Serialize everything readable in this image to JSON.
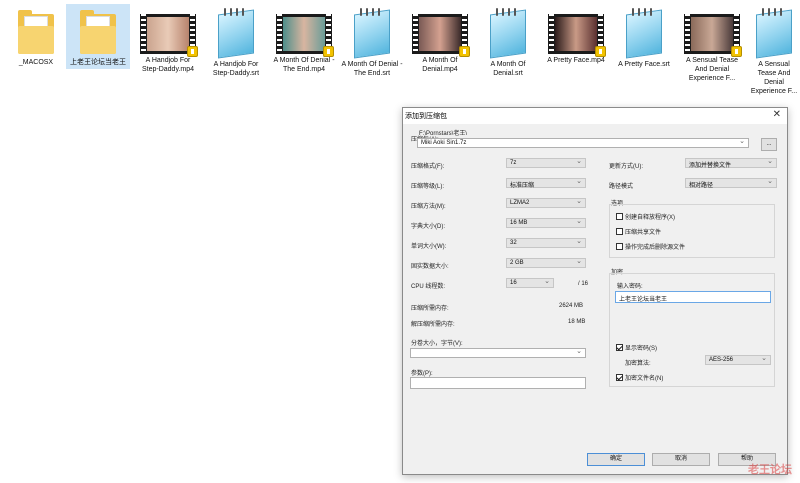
{
  "files": [
    {
      "name": "_MACOSX",
      "kind": "folder"
    },
    {
      "name": "上老王论坛当老王",
      "kind": "folder"
    },
    {
      "name": "A Handjob For Step-Daddy.mp4",
      "kind": "video"
    },
    {
      "name": "A Handjob For Step-Daddy.srt",
      "kind": "notepad"
    },
    {
      "name": "A Month Of Denial - The End.mp4",
      "kind": "video"
    },
    {
      "name": "A Month Of Denial - The End.srt",
      "kind": "notepad"
    },
    {
      "name": "A Month Of Denial.mp4",
      "kind": "video"
    },
    {
      "name": "A Month Of Denial.srt",
      "kind": "notepad"
    },
    {
      "name": "A Pretty Face.mp4",
      "kind": "video"
    },
    {
      "name": "A Pretty Face.srt",
      "kind": "notepad"
    },
    {
      "name": "A Sensual Tease And Denial Experience F...",
      "kind": "video"
    },
    {
      "name": "A Sensual Tease And Denial Experience F...",
      "kind": "notepad"
    }
  ],
  "dialog": {
    "title": "添加到压缩包",
    "close": "✕",
    "archive_label": "压缩包(A):",
    "archive_path": "F:\\Pornstars\\老王\\",
    "archive_name": "Miki Aoki Sin1.7z",
    "browse": "...",
    "format_label": "压缩格式(F):",
    "format_value": "7z",
    "level_label": "压缩等级(L):",
    "level_value": "标准压缩",
    "method_label": "压缩方法(M):",
    "method_value": "LZMA2",
    "dict_label": "字典大小(D):",
    "dict_value": "16 MB",
    "word_label": "单词大小(W):",
    "word_value": "32",
    "solid_label": "固实数据大小:",
    "solid_value": "2 GB",
    "threads_label": "CPU 线程数:",
    "threads_value": "16",
    "threads_max": "/ 16",
    "mem_comp_label": "压缩所需内存:",
    "mem_comp_value": "2624 MB",
    "mem_decomp_label": "解压缩所需内存:",
    "mem_decomp_value": "18 MB",
    "split_label": "分卷大小，字节(V):",
    "split_value": "",
    "params_label": "参数(P):",
    "params_value": "",
    "update_label": "更新方式(U):",
    "update_value": "添加并替换文件",
    "path_label": "路径模式",
    "path_value": "相对路径",
    "options_title": "选项",
    "opt_sfx": "创建自释放程序(X)",
    "opt_shared": "压缩共享文件",
    "opt_delete": "操作完成后删除源文件",
    "encrypt_title": "加密",
    "password_label": "输入密码:",
    "password_value": "上老王论坛当老王",
    "show_pw": "显示密码(S)",
    "enc_method_label": "加密算法:",
    "enc_method_value": "AES-256",
    "enc_names": "加密文件名(N)",
    "ok": "确定",
    "cancel": "取消",
    "help": "帮助"
  },
  "watermark": "老王论坛"
}
